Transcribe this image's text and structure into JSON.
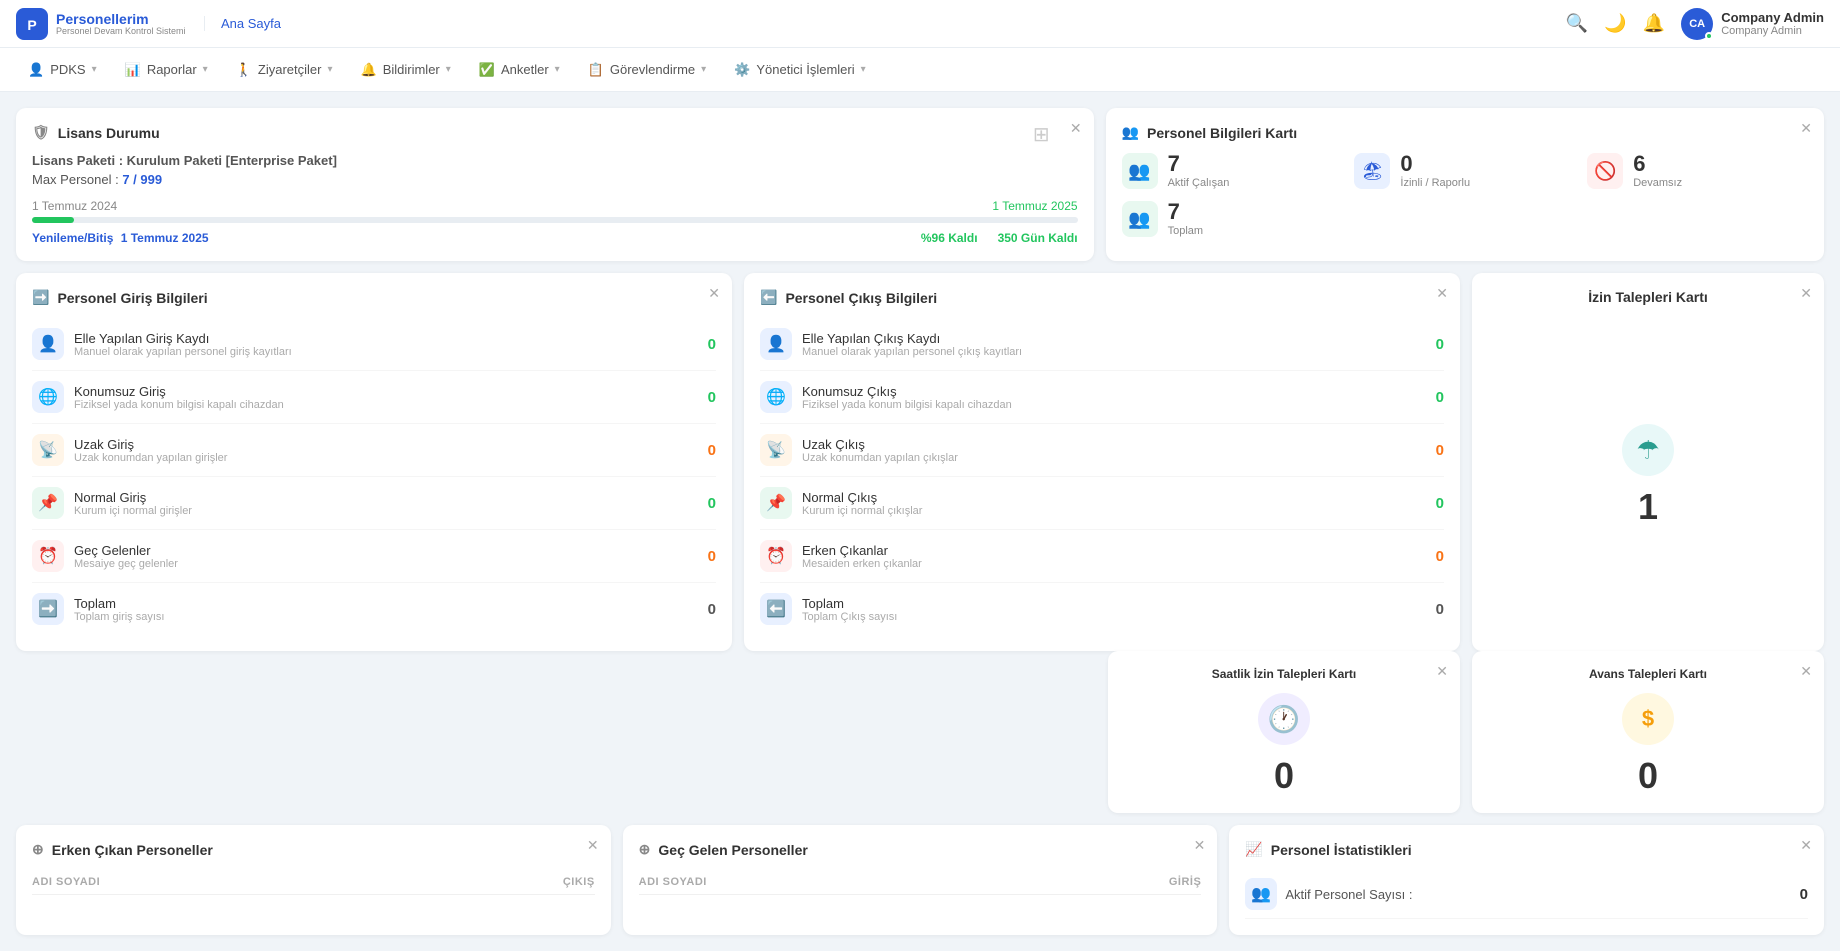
{
  "app": {
    "logo_title": "Personellerim",
    "logo_sub": "Personel Devam Kontrol Sistemi",
    "logo_initials": "P"
  },
  "topnav": {
    "home_label": "Ana Sayfa",
    "user_name": "Company Admin",
    "user_role": "Company Admin",
    "user_initials": "CA"
  },
  "menubar": {
    "items": [
      {
        "icon": "👤",
        "label": "PDKS",
        "has_chevron": true
      },
      {
        "icon": "📊",
        "label": "Raporlar",
        "has_chevron": true
      },
      {
        "icon": "🚶",
        "label": "Ziyaretçiler",
        "has_chevron": true
      },
      {
        "icon": "🔔",
        "label": "Bildirimler",
        "has_chevron": true
      },
      {
        "icon": "✅",
        "label": "Anketler",
        "has_chevron": true
      },
      {
        "icon": "📋",
        "label": "Görevlendirme",
        "has_chevron": true
      },
      {
        "icon": "⚙️",
        "label": "Yönetici İşlemleri",
        "has_chevron": true
      }
    ]
  },
  "license_card": {
    "title": "Lisans Durumu",
    "package_label": "Lisans Paketi :",
    "package_value": "Kurulum Paketi [Enterprise Paket]",
    "max_label": "Max Personel :",
    "max_value": "7 / 999",
    "start_date": "1 Temmuz 2024",
    "end_date": "1 Temmuz 2025",
    "progress_percent": 4,
    "renew_label": "Yenileme/Bitiş",
    "renew_date": "1 Temmuz 2025",
    "remaining_percent": "%96 Kaldı",
    "remaining_days": "350 Gün Kaldı"
  },
  "personnel_info_card": {
    "title": "Personel Bilgileri Kartı",
    "aktif": {
      "number": "7",
      "label": "Aktif Çalışan"
    },
    "izinli": {
      "number": "0",
      "label": "İzinli / Raporlu"
    },
    "devamsiz": {
      "number": "6",
      "label": "Devamsız"
    },
    "toplam": {
      "number": "7",
      "label": "Toplam"
    }
  },
  "entry_card": {
    "title": "Personel Giriş Bilgileri",
    "rows": [
      {
        "icon": "👤+",
        "icon_bg": "blue",
        "title": "Elle Yapılan Giriş Kaydı",
        "sub": "Manuel olarak yapılan personel giriş kayıtları",
        "count": "0",
        "count_class": "count-zero"
      },
      {
        "icon": "🌐",
        "icon_bg": "blue",
        "title": "Konumsuz Giriş",
        "sub": "Fiziksel yada konum bilgisi kapalı cihazdan",
        "count": "0",
        "count_class": "count-zero"
      },
      {
        "icon": "📡",
        "icon_bg": "orange",
        "title": "Uzak Giriş",
        "sub": "Uzak konumdan yapılan girişler",
        "count": "0",
        "count_class": "count-orange"
      },
      {
        "icon": "📌",
        "icon_bg": "green",
        "title": "Normal Giriş",
        "sub": "Kurum içi normal girişler",
        "count": "0",
        "count_class": "count-zero"
      },
      {
        "icon": "🔴",
        "icon_bg": "red",
        "title": "Geç Gelenler",
        "sub": "Mesaiye geç gelenler",
        "count": "0",
        "count_class": "count-orange"
      },
      {
        "icon": "➡️",
        "icon_bg": "blue",
        "title": "Toplam",
        "sub": "Toplam giriş sayısı",
        "count": "0",
        "count_class": ""
      }
    ]
  },
  "exit_card": {
    "title": "Personel Çıkış Bilgileri",
    "rows": [
      {
        "icon": "👤-",
        "icon_bg": "blue",
        "title": "Elle Yapılan Çıkış Kaydı",
        "sub": "Manuel olarak yapılan personel çıkış kayıtları",
        "count": "0",
        "count_class": "count-zero"
      },
      {
        "icon": "🌐",
        "icon_bg": "blue",
        "title": "Konumsuz Çıkış",
        "sub": "Fiziksel yada konum bilgisi kapalı cihazdan",
        "count": "0",
        "count_class": "count-zero"
      },
      {
        "icon": "📡",
        "icon_bg": "orange",
        "title": "Uzak Çıkış",
        "sub": "Uzak konumdan yapılan çıkışlar",
        "count": "0",
        "count_class": "count-orange"
      },
      {
        "icon": "📌",
        "icon_bg": "green",
        "title": "Normal Çıkış",
        "sub": "Kurum içi normal çıkışlar",
        "count": "0",
        "count_class": "count-zero"
      },
      {
        "icon": "⏰",
        "icon_bg": "red",
        "title": "Erken Çıkanlar",
        "sub": "Mesaiden erken çıkanlar",
        "count": "0",
        "count_class": "count-orange"
      },
      {
        "icon": "⬅️",
        "icon_bg": "blue",
        "title": "Toplam",
        "sub": "Toplam Çıkış sayısı",
        "count": "0",
        "count_class": ""
      }
    ]
  },
  "leave_card": {
    "title": "İzin Talepleri Kartı",
    "icon": "☂️",
    "count": "1",
    "icon_color": "#2a9d8f"
  },
  "hourly_leave_card": {
    "title": "Saatlik İzin Talepleri Kartı",
    "icon": "🕐",
    "count": "0",
    "icon_color": "#6c63ff"
  },
  "advance_card": {
    "title": "Avans Talepleri Kartı",
    "icon": "$",
    "count": "0",
    "icon_color": "#f59e0b"
  },
  "early_exit_card": {
    "title": "Erken Çıkan Personeller",
    "col1": "ADI SOYADI",
    "col2": "ÇIKIŞ"
  },
  "late_arrival_card": {
    "title": "Geç Gelen Personeller",
    "col1": "ADI SOYADI",
    "col2": "GİRİŞ"
  },
  "personnel_stats_card": {
    "title": "Personel İstatistikleri",
    "aktif_label": "Aktif Personel Sayısı :",
    "aktif_value": "0"
  }
}
